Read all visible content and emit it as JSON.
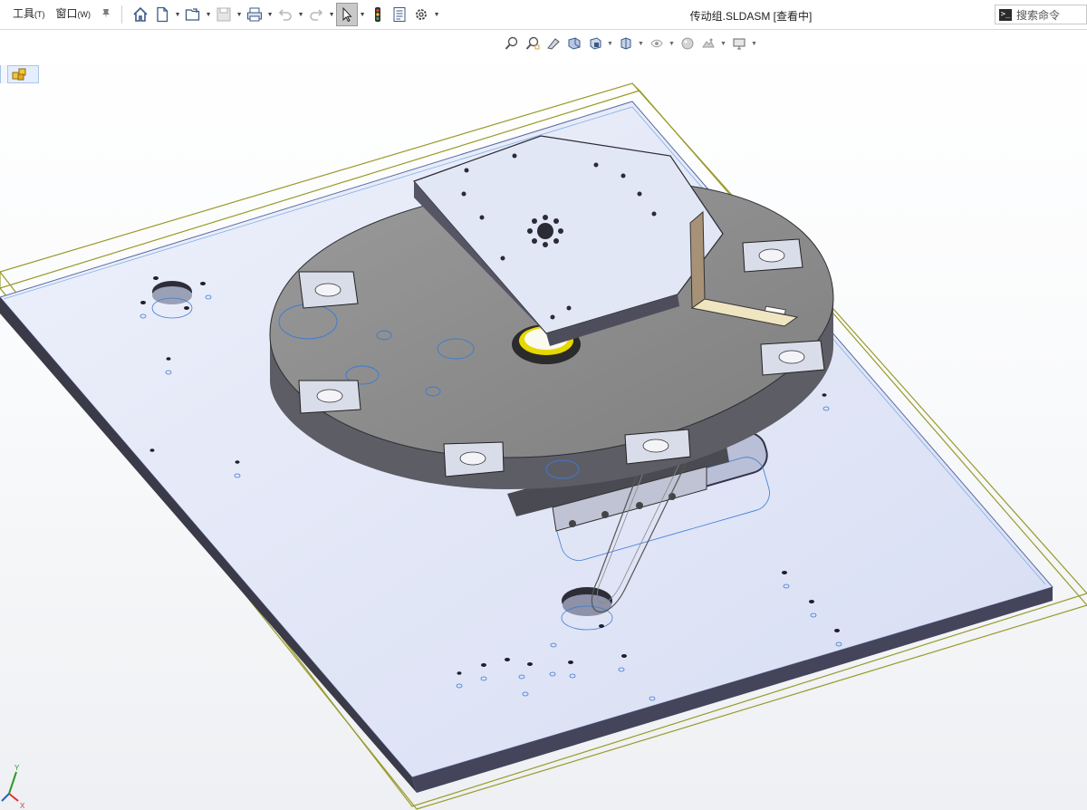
{
  "menu": {
    "tools": {
      "label": "工具",
      "key": "(T)"
    },
    "window": {
      "label": "窗口",
      "key": "(W)"
    }
  },
  "toolbar": {
    "icons": [
      "home-icon",
      "new-document-icon",
      "open-folder-icon",
      "save-icon",
      "print-icon",
      "undo-icon",
      "redo-icon",
      "select-pointer-icon",
      "traffic-light-icon",
      "file-properties-icon",
      "options-gear-icon"
    ]
  },
  "title": "传动组.SLDASM [查看中]",
  "search": {
    "placeholder": "搜索命令"
  },
  "heads_up_toolbar": {
    "icons": [
      "zoom-to-fit-icon",
      "zoom-to-area-icon",
      "previous-view-icon",
      "section-view-icon",
      "view-orientation-icon",
      "display-style-icon",
      "hide-show-icon",
      "edit-appearance-icon",
      "apply-scene-icon",
      "view-settings-icon"
    ]
  },
  "feature_tree_tab": {
    "icon": "assembly-icon"
  },
  "triad": {
    "y_label": "Y",
    "x_label": "X"
  },
  "colors": {
    "base_plate": "#dfe5f7",
    "base_plate_edge": "#3a3a48",
    "turntable": "#8c8c8c",
    "turntable_side": "#5d5d66",
    "top_plate": "#e2e7f6",
    "bracket_wood": "#a89277",
    "bracket_light": "#efe5c0",
    "bounding_box": "#9a9a2a",
    "hole_outline": "#3b7bd4",
    "bearing_yellow": "#e6d800"
  }
}
